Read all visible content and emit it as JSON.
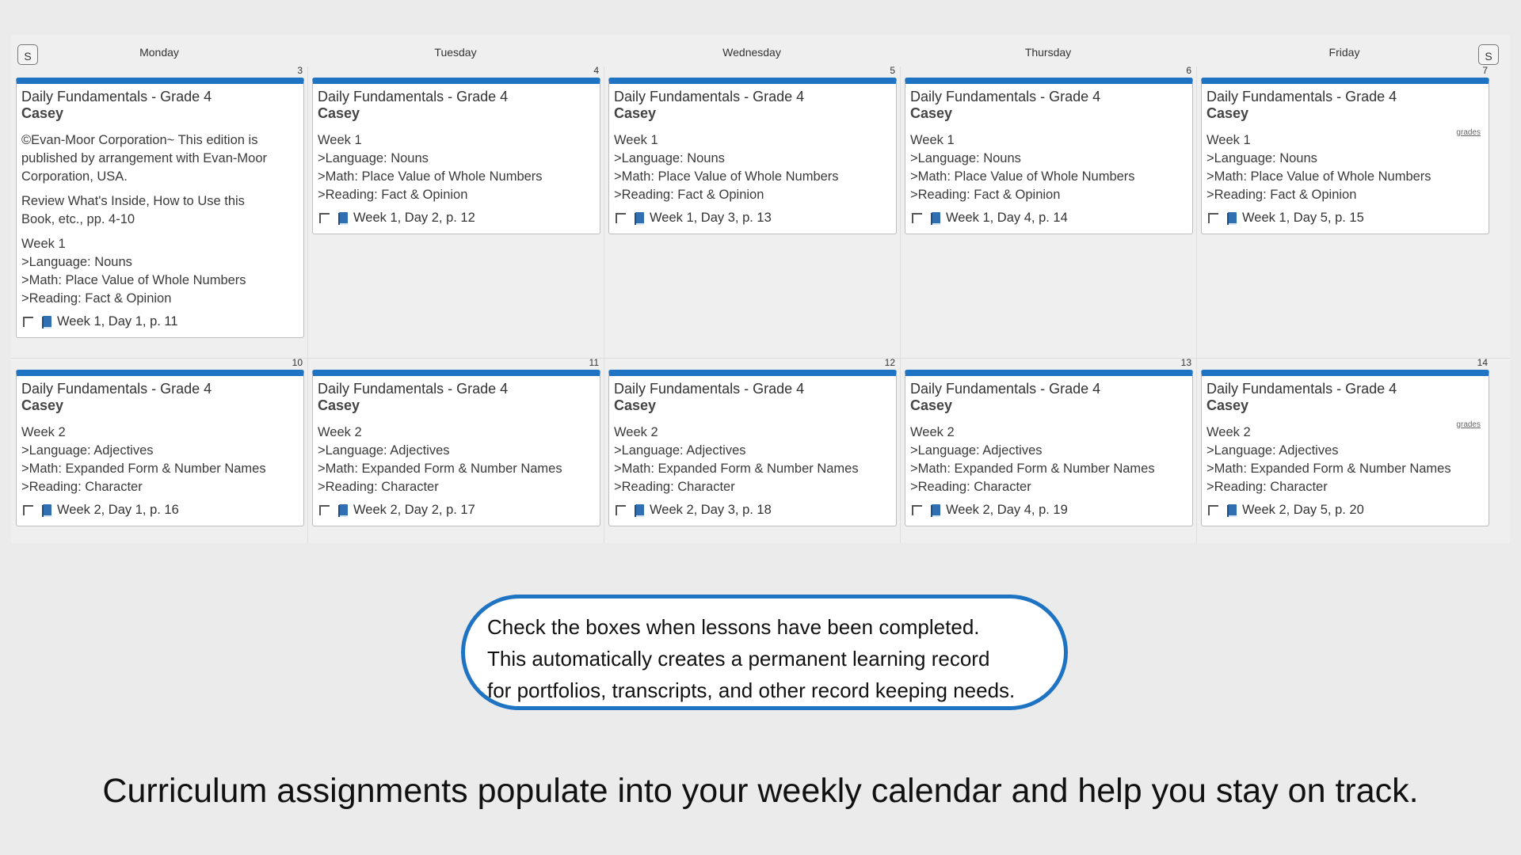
{
  "calendar": {
    "prev_week_label": "S",
    "next_week_label": "S",
    "days": [
      "Monday",
      "Tuesday",
      "Wednesday",
      "Thursday",
      "Friday"
    ],
    "weeks": [
      {
        "cells": [
          {
            "date": "3",
            "title": "Daily Fundamentals - Grade 4",
            "student": "Casey",
            "grades_link": "",
            "notes": [
              [
                "©Evan-Moor Corporation~ This edition is",
                "published by arrangement with Evan-Moor",
                "Corporation, USA."
              ],
              [
                "Review What's Inside, How to Use this",
                "Book, etc., pp. 4-10"
              ],
              [
                "Week 1",
                ">Language: Nouns",
                ">Math: Place Value of Whole Numbers",
                ">Reading: Fact & Opinion"
              ]
            ],
            "lesson": "Week 1, Day 1, p. 11"
          },
          {
            "date": "4",
            "title": "Daily Fundamentals - Grade 4",
            "student": "Casey",
            "grades_link": "",
            "notes": [
              [
                "Week 1",
                ">Language: Nouns",
                ">Math: Place Value of Whole Numbers",
                ">Reading: Fact & Opinion"
              ]
            ],
            "lesson": "Week 1, Day 2, p. 12"
          },
          {
            "date": "5",
            "title": "Daily Fundamentals - Grade 4",
            "student": "Casey",
            "grades_link": "",
            "notes": [
              [
                "Week 1",
                ">Language: Nouns",
                ">Math: Place Value of Whole Numbers",
                ">Reading: Fact & Opinion"
              ]
            ],
            "lesson": "Week 1, Day 3, p. 13"
          },
          {
            "date": "6",
            "title": "Daily Fundamentals - Grade 4",
            "student": "Casey",
            "grades_link": "",
            "notes": [
              [
                "Week 1",
                ">Language: Nouns",
                ">Math: Place Value of Whole Numbers",
                ">Reading: Fact & Opinion"
              ]
            ],
            "lesson": "Week 1, Day 4, p. 14"
          },
          {
            "date": "7",
            "title": "Daily Fundamentals - Grade 4",
            "student": "Casey",
            "grades_link": "grades",
            "notes": [
              [
                "Week 1",
                ">Language: Nouns",
                ">Math: Place Value of Whole Numbers",
                ">Reading: Fact & Opinion"
              ]
            ],
            "lesson": "Week 1, Day 5, p. 15"
          }
        ]
      },
      {
        "cells": [
          {
            "date": "10",
            "title": "Daily Fundamentals - Grade 4",
            "student": "Casey",
            "grades_link": "",
            "notes": [
              [
                "Week 2",
                ">Language: Adjectives",
                ">Math: Expanded Form & Number Names",
                ">Reading: Character"
              ]
            ],
            "lesson": "Week 2, Day 1, p. 16"
          },
          {
            "date": "11",
            "title": "Daily Fundamentals - Grade 4",
            "student": "Casey",
            "grades_link": "",
            "notes": [
              [
                "Week 2",
                ">Language: Adjectives",
                ">Math: Expanded Form & Number Names",
                ">Reading: Character"
              ]
            ],
            "lesson": "Week 2, Day 2, p. 17"
          },
          {
            "date": "12",
            "title": "Daily Fundamentals - Grade 4",
            "student": "Casey",
            "grades_link": "",
            "notes": [
              [
                "Week 2",
                ">Language: Adjectives",
                ">Math: Expanded Form & Number Names",
                ">Reading: Character"
              ]
            ],
            "lesson": "Week 2, Day 3, p. 18"
          },
          {
            "date": "13",
            "title": "Daily Fundamentals - Grade 4",
            "student": "Casey",
            "grades_link": "",
            "notes": [
              [
                "Week 2",
                ">Language: Adjectives",
                ">Math: Expanded Form & Number Names",
                ">Reading: Character"
              ]
            ],
            "lesson": "Week 2, Day 4, p. 19"
          },
          {
            "date": "14",
            "title": "Daily Fundamentals - Grade 4",
            "student": "Casey",
            "grades_link": "grades",
            "notes": [
              [
                "Week 2",
                ">Language: Adjectives",
                ">Math: Expanded Form & Number Names",
                ">Reading: Character"
              ]
            ],
            "lesson": "Week 2, Day 5, p. 20"
          }
        ]
      }
    ]
  },
  "callout": {
    "lines": [
      "Check the boxes when lessons have been completed.",
      "This automatically creates a permanent learning record",
      "for portfolios, transcripts, and other record keeping needs."
    ]
  },
  "caption": "Curriculum assignments populate into your weekly calendar and help you stay on track.",
  "colors": {
    "accent": "#1f73c3",
    "book_icon": "#2f6fb2",
    "background": "#ebebeb"
  },
  "icons": {
    "checkbox": "checkbox-icon",
    "lesson": "book-icon"
  }
}
